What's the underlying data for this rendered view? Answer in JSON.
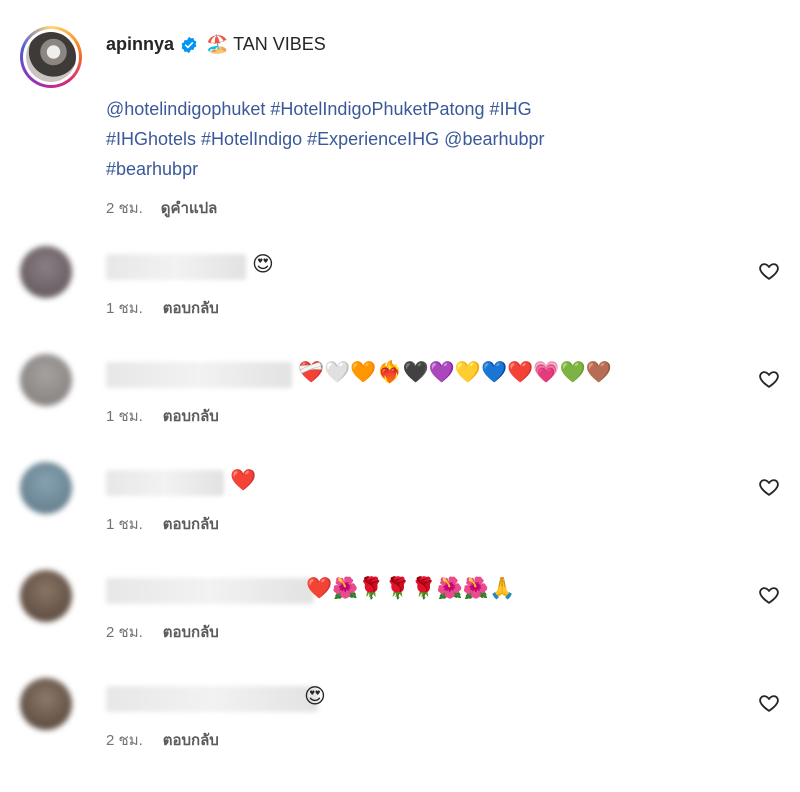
{
  "post": {
    "username": "apinnya",
    "header_text": "🏖️ TAN VIBES",
    "caption_line1": "@hotelindigophuket #HotelIndigoPhuketPatong #IHG",
    "caption_line2": "#IHGhotels #HotelIndigo #ExperienceIHG @bearhubpr",
    "caption_line3": "#bearhubpr",
    "time": "2 ชม.",
    "translate_label": "ดูคำแปล"
  },
  "comments": [
    {
      "text": "😍",
      "time": "1 ชม.",
      "reply_label": "ตอบกลับ",
      "avatar_color": "#6e6468"
    },
    {
      "text": "❤️‍🩹🤍🧡❤️‍🔥🖤💜💛💙❤️💗💚🤎",
      "time": "1 ชม.",
      "reply_label": "ตอบกลับ",
      "avatar_color": "#8e8a88"
    },
    {
      "text": "❤️",
      "time": "1 ชม.",
      "reply_label": "ตอบกลับ",
      "avatar_color": "#6f8a99"
    },
    {
      "text": "❤️🌺🌹🌹🌹🌺🌺🙏",
      "time": "2 ชม.",
      "reply_label": "ตอบกลับ",
      "avatar_color": "#6b5a4c"
    },
    {
      "text": "😍",
      "time": "2 ชม.",
      "reply_label": "ตอบกลับ",
      "avatar_color": "#6d5d50"
    }
  ],
  "icons": {
    "verified": "verified-badge-icon",
    "like": "heart-outline-icon"
  },
  "colors": {
    "link": "#385185",
    "meta": "#737373",
    "verified": "#0095f6"
  }
}
